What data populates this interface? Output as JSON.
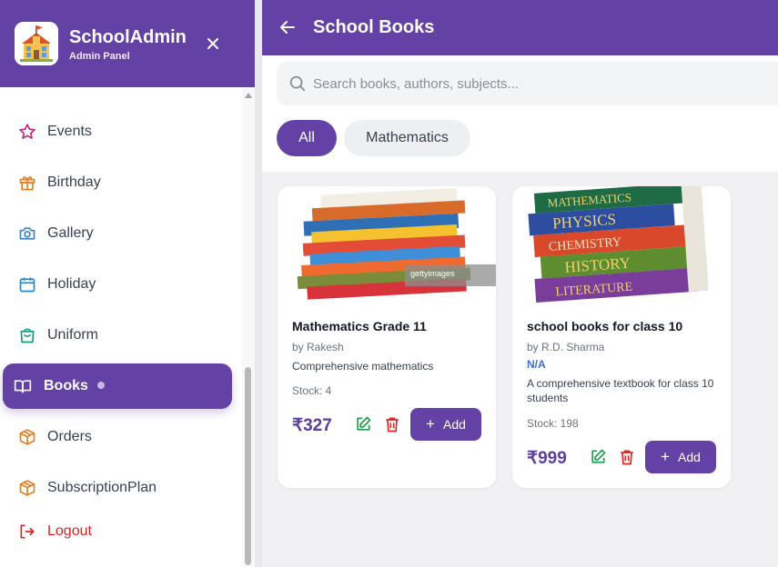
{
  "sidebar": {
    "brand_title": "SchoolAdmin",
    "brand_subtitle": "Admin Panel",
    "items": [
      {
        "label": "Events",
        "icon": "star-icon"
      },
      {
        "label": "Birthday",
        "icon": "gift-icon"
      },
      {
        "label": "Gallery",
        "icon": "camera-icon"
      },
      {
        "label": "Holiday",
        "icon": "calendar-icon"
      },
      {
        "label": "Uniform",
        "icon": "shopping-bag-icon"
      },
      {
        "label": "Books",
        "icon": "book-open-icon",
        "active": true
      },
      {
        "label": "Orders",
        "icon": "package-icon"
      },
      {
        "label": "SubscriptionPlan",
        "icon": "package-icon"
      },
      {
        "label": "Logout",
        "icon": "logout-icon"
      }
    ]
  },
  "header": {
    "title": "School Books"
  },
  "search": {
    "placeholder": "Search books, authors, subjects..."
  },
  "filters": [
    {
      "label": "All",
      "active": true
    },
    {
      "label": "Mathematics",
      "active": false
    }
  ],
  "books": [
    {
      "title": "Mathematics Grade 11",
      "author": "by Rakesh",
      "subject": "",
      "description": "Comprehensive mathematics",
      "stock": "Stock: 4",
      "price": "₹327",
      "add_label": "Add",
      "image_watermark": "gettyimages"
    },
    {
      "title": "school books for class 10",
      "author": "by R.D. Sharma",
      "subject": "N/A",
      "description": "A comprehensive textbook for class 10 students",
      "stock": "Stock: 198",
      "price": "₹999",
      "add_label": "Add",
      "spine_labels": [
        "MATHEMATICS",
        "PHYSICS",
        "CHEMISTRY",
        "HISTORY",
        "LITERATURE"
      ]
    }
  ],
  "colors": {
    "primary": "#6441a5",
    "price": "#5b3fa0",
    "edit": "#16a34a",
    "delete": "#dc2626",
    "logout": "#dc2626",
    "subject": "#3b6fd4"
  }
}
